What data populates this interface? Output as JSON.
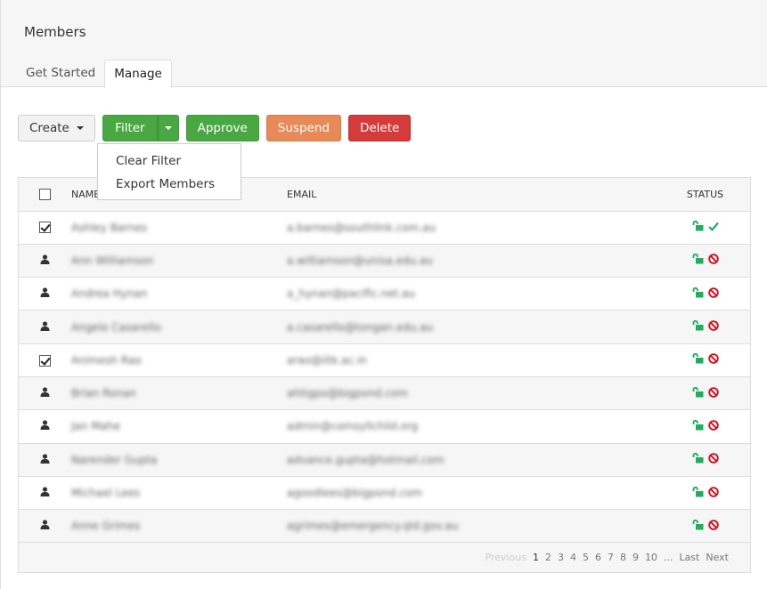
{
  "page": {
    "title": "Members"
  },
  "tabs": [
    {
      "label": "Get Started",
      "active": false
    },
    {
      "label": "Manage",
      "active": true
    }
  ],
  "toolbar": {
    "create_label": "Create",
    "filter_label": "Filter",
    "approve_label": "Approve",
    "suspend_label": "Suspend",
    "delete_label": "Delete"
  },
  "filter_menu": {
    "items": [
      "Clear Filter",
      "Export Members"
    ]
  },
  "table": {
    "headers": {
      "name": "NAME",
      "email": "EMAIL",
      "status": "STATUS"
    },
    "rows": [
      {
        "selected": true,
        "name": "Ashley Barnes",
        "email": "a.barnes@southlink.com.au",
        "unlocked": true,
        "approved": true
      },
      {
        "selected": false,
        "name": "Ann Williamson",
        "email": "a.williamson@unisa.edu.au",
        "unlocked": true,
        "approved": false
      },
      {
        "selected": false,
        "name": "Andrea Hynan",
        "email": "a_hynan@pacific.net.au",
        "unlocked": true,
        "approved": false
      },
      {
        "selected": false,
        "name": "Angelo Casarello",
        "email": "a.casarello@tongan.edu.au",
        "unlocked": true,
        "approved": false
      },
      {
        "selected": true,
        "name": "Animesh Rao",
        "email": "arao@iitk.ac.in",
        "unlocked": true,
        "approved": false
      },
      {
        "selected": false,
        "name": "Brian Ronan",
        "email": "ahtigpo@bigpond.com",
        "unlocked": true,
        "approved": false
      },
      {
        "selected": false,
        "name": "Jan Mahe",
        "email": "admin@comsyllchild.org",
        "unlocked": true,
        "approved": false
      },
      {
        "selected": false,
        "name": "Narender Gupta",
        "email": "advance.gupta@hotmail.com",
        "unlocked": true,
        "approved": false
      },
      {
        "selected": false,
        "name": "Michael Lees",
        "email": "agoodlees@bigpond.com",
        "unlocked": true,
        "approved": false
      },
      {
        "selected": false,
        "name": "Anne Grimes",
        "email": "agrimes@emergency.qld.gov.au",
        "unlocked": true,
        "approved": false
      }
    ]
  },
  "pagination": {
    "previous": "Previous",
    "pages": [
      "1",
      "2",
      "3",
      "4",
      "5",
      "6",
      "7",
      "8",
      "9",
      "10"
    ],
    "current": "1",
    "ellipsis": "...",
    "last": "Last",
    "next": "Next"
  },
  "colors": {
    "green": "#4aa843",
    "orange": "#e78a57",
    "red": "#d53b3b",
    "status_unlock": "#1fae5b",
    "status_approved": "#1fae5b",
    "status_blocked": "#d0101e"
  }
}
